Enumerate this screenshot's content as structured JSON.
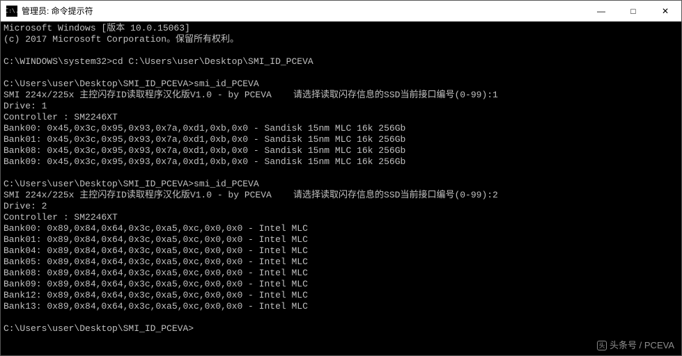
{
  "titlebar": {
    "icon_label": "C:\\.",
    "title": "管理员: 命令提示符"
  },
  "controls": {
    "min": "—",
    "max": "□",
    "close": "✕"
  },
  "console": {
    "header": [
      "Microsoft Windows [版本 10.0.15063]",
      "(c) 2017 Microsoft Corporation。保留所有权利。",
      ""
    ],
    "prompt1": "C:\\WINDOWS\\system32>cd C:\\Users\\user\\Desktop\\SMI_ID_PCEVA",
    "blank1": "",
    "prompt2": "C:\\Users\\user\\Desktop\\SMI_ID_PCEVA>smi_id_PCEVA",
    "run1_title": "SMI 224x/225x 主控闪存ID读取程序汉化版V1.0 - by PCEVA    请选择读取闪存信息的SSD当前接口编号(0-99):1",
    "run1_drive": "Drive: 1",
    "run1_ctrl": "Controller : SM2246XT",
    "run1_banks": [
      "Bank00: 0x45,0x3c,0x95,0x93,0x7a,0xd1,0xb,0x0 - Sandisk 15nm MLC 16k 256Gb",
      "Bank01: 0x45,0x3c,0x95,0x93,0x7a,0xd1,0xb,0x0 - Sandisk 15nm MLC 16k 256Gb",
      "Bank08: 0x45,0x3c,0x95,0x93,0x7a,0xd1,0xb,0x0 - Sandisk 15nm MLC 16k 256Gb",
      "Bank09: 0x45,0x3c,0x95,0x93,0x7a,0xd1,0xb,0x0 - Sandisk 15nm MLC 16k 256Gb"
    ],
    "blank2": "",
    "prompt3": "C:\\Users\\user\\Desktop\\SMI_ID_PCEVA>smi_id_PCEVA",
    "run2_title": "SMI 224x/225x 主控闪存ID读取程序汉化版V1.0 - by PCEVA    请选择读取闪存信息的SSD当前接口编号(0-99):2",
    "run2_drive": "Drive: 2",
    "run2_ctrl": "Controller : SM2246XT",
    "run2_banks": [
      "Bank00: 0x89,0x84,0x64,0x3c,0xa5,0xc,0x0,0x0 - Intel MLC",
      "Bank01: 0x89,0x84,0x64,0x3c,0xa5,0xc,0x0,0x0 - Intel MLC",
      "Bank04: 0x89,0x84,0x64,0x3c,0xa5,0xc,0x0,0x0 - Intel MLC",
      "Bank05: 0x89,0x84,0x64,0x3c,0xa5,0xc,0x0,0x0 - Intel MLC",
      "Bank08: 0x89,0x84,0x64,0x3c,0xa5,0xc,0x0,0x0 - Intel MLC",
      "Bank09: 0x89,0x84,0x64,0x3c,0xa5,0xc,0x0,0x0 - Intel MLC",
      "Bank12: 0x89,0x84,0x64,0x3c,0xa5,0xc,0x0,0x0 - Intel MLC",
      "Bank13: 0x89,0x84,0x64,0x3c,0xa5,0xc,0x0,0x0 - Intel MLC"
    ],
    "blank3": "",
    "prompt4": "C:\\Users\\user\\Desktop\\SMI_ID_PCEVA>"
  },
  "watermark": {
    "text": "头条号 / PCEVA"
  }
}
